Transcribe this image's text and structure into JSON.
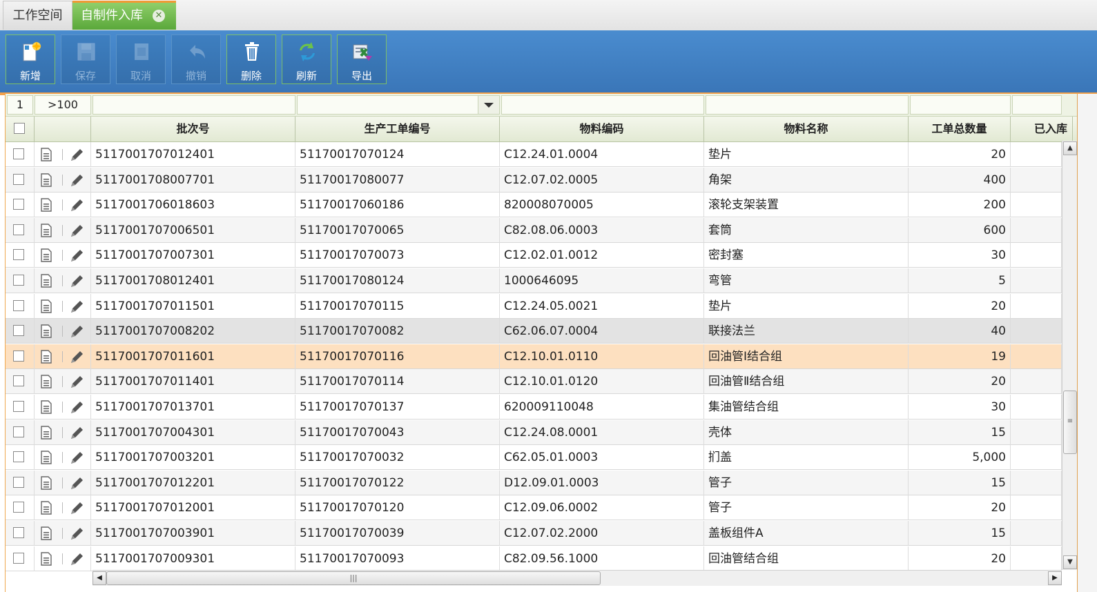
{
  "tabs": {
    "workspace": "工作空间",
    "active": "自制件入库",
    "close_glyph": "✕"
  },
  "toolbar": {
    "add": "新增",
    "save": "保存",
    "cancel": "取消",
    "undo": "撤销",
    "delete": "删除",
    "refresh": "刷新",
    "export": "导出"
  },
  "pager": {
    "page": "1",
    "count": ">100"
  },
  "columns": {
    "batch": "批次号",
    "order": "生产工单编号",
    "code": "物料编码",
    "name": "物料名称",
    "qty": "工单总数量",
    "stocked": "已入库"
  },
  "rows": [
    {
      "batch": "5117001707012401",
      "order": "51170017070124",
      "code": "C12.24.01.0004",
      "name": "垫片",
      "qty": "20"
    },
    {
      "batch": "5117001708007701",
      "order": "51170017080077",
      "code": "C12.07.02.0005",
      "name": "角架",
      "qty": "400"
    },
    {
      "batch": "5117001706018603",
      "order": "51170017060186",
      "code": "820008070005",
      "name": "滚轮支架装置",
      "qty": "200"
    },
    {
      "batch": "5117001707006501",
      "order": "51170017070065",
      "code": "C82.08.06.0003",
      "name": "套筒",
      "qty": "600"
    },
    {
      "batch": "5117001707007301",
      "order": "51170017070073",
      "code": "C12.02.01.0012",
      "name": "密封塞",
      "qty": "30"
    },
    {
      "batch": "5117001708012401",
      "order": "51170017080124",
      "code": "1000646095",
      "name": "弯管",
      "qty": "5"
    },
    {
      "batch": "5117001707011501",
      "order": "51170017070115",
      "code": "C12.24.05.0021",
      "name": "垫片",
      "qty": "20"
    },
    {
      "batch": "5117001707008202",
      "order": "51170017070082",
      "code": "C62.06.07.0004",
      "name": "联接法兰",
      "qty": "40"
    },
    {
      "batch": "5117001707011601",
      "order": "51170017070116",
      "code": "C12.10.01.0110",
      "name": "回油管Ⅰ结合组",
      "qty": "19"
    },
    {
      "batch": "5117001707011401",
      "order": "51170017070114",
      "code": "C12.10.01.0120",
      "name": "回油管Ⅱ结合组",
      "qty": "20"
    },
    {
      "batch": "5117001707013701",
      "order": "51170017070137",
      "code": "620009110048",
      "name": "集油管结合组",
      "qty": "30"
    },
    {
      "batch": "5117001707004301",
      "order": "51170017070043",
      "code": "C12.24.08.0001",
      "name": "壳体",
      "qty": "15"
    },
    {
      "batch": "5117001707003201",
      "order": "51170017070032",
      "code": "C62.05.01.0003",
      "name": "扪盖",
      "qty": "5,000"
    },
    {
      "batch": "5117001707012201",
      "order": "51170017070122",
      "code": "D12.09.01.0003",
      "name": "管子",
      "qty": "15"
    },
    {
      "batch": "5117001707012001",
      "order": "51170017070120",
      "code": "C12.09.06.0002",
      "name": "管子",
      "qty": "20"
    },
    {
      "batch": "5117001707003901",
      "order": "51170017070039",
      "code": "C12.07.02.2000",
      "name": "盖板组件A",
      "qty": "15"
    },
    {
      "batch": "5117001707009301",
      "order": "51170017070093",
      "code": "C82.09.56.1000",
      "name": "回油管结合组",
      "qty": "20"
    }
  ],
  "row_states": {
    "hover_index": 7,
    "selected_index": 8
  },
  "colors": {
    "accent_orange": "#f2a04a",
    "toolbar_blue": "#3e7fc0",
    "tab_green": "#5aa83a",
    "selected_row": "#fde0c0"
  }
}
